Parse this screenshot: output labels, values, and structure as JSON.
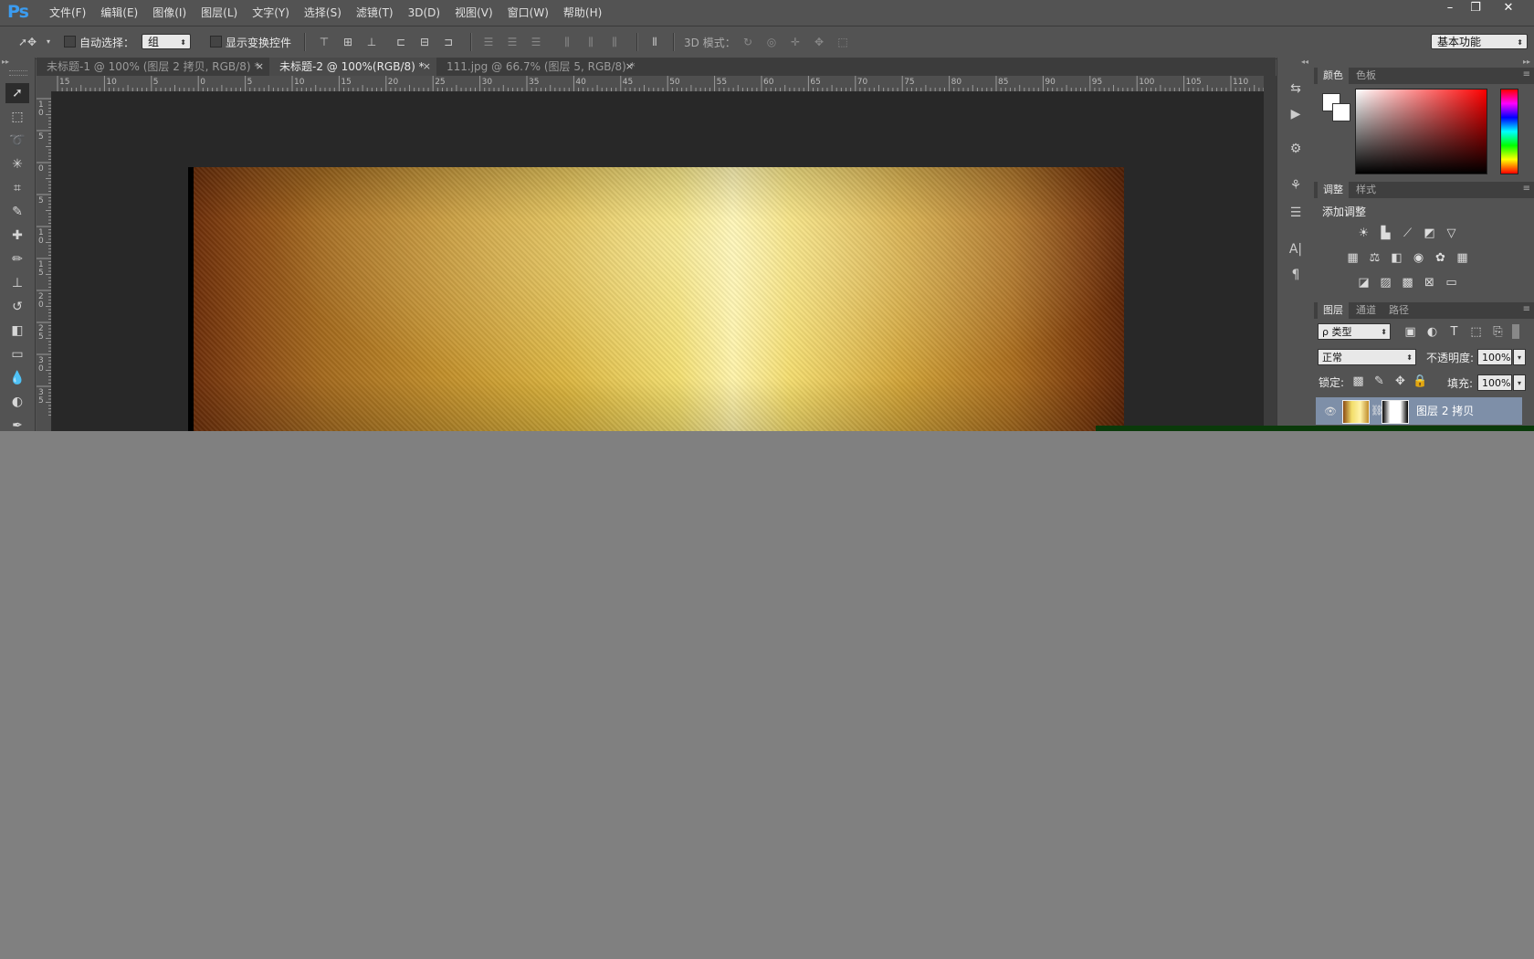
{
  "app": {
    "logo": "Ps"
  },
  "menubar": {
    "items": [
      "文件(F)",
      "编辑(E)",
      "图像(I)",
      "图层(L)",
      "文字(Y)",
      "选择(S)",
      "滤镜(T)",
      "3D(D)",
      "视图(V)",
      "窗口(W)",
      "帮助(H)"
    ],
    "minimize": "–",
    "restore": "❐",
    "close": "✕"
  },
  "options": {
    "auto_select_label": "自动选择：",
    "auto_select_value": "组",
    "show_transform_label": "显示变换控件",
    "mode_3d_label": "3D 模式：",
    "workspace": "基本功能"
  },
  "tabs": [
    {
      "title": "未标题-1 @ 100% (图层 2 拷贝, RGB/8) *",
      "close": "×"
    },
    {
      "title": "未标题-2 @ 100%(RGB/8) *",
      "close": "×"
    },
    {
      "title": "111.jpg @ 66.7% (图层 5, RGB/8) *",
      "close": "×"
    }
  ],
  "ruler": {
    "h_labels": [
      "15",
      "10",
      "5",
      "0",
      "5",
      "10",
      "15",
      "20",
      "25",
      "30",
      "35",
      "40",
      "45",
      "50",
      "55",
      "60",
      "65",
      "70",
      "75",
      "80",
      "85",
      "90",
      "95",
      "100",
      "105",
      "110"
    ],
    "v_labels": [
      "1\n0",
      "5",
      "0",
      "5",
      "1\n0",
      "1\n5",
      "2\n0",
      "2\n5",
      "3\n0",
      "3\n5"
    ]
  },
  "panels": {
    "color_tabs": [
      "颜色",
      "色板"
    ],
    "adjust_tabs": [
      "调整",
      "样式"
    ],
    "add_adjustment": "添加调整",
    "layer_tabs": [
      "图层",
      "通道",
      "路径"
    ],
    "filter_kind": "ρ 类型",
    "blend_mode": "正常",
    "opacity_label": "不透明度:",
    "opacity_value": "100%",
    "lock_label": "锁定:",
    "fill_label": "填充:",
    "fill_value": "100%",
    "layer_name": "图层 2 拷贝"
  }
}
